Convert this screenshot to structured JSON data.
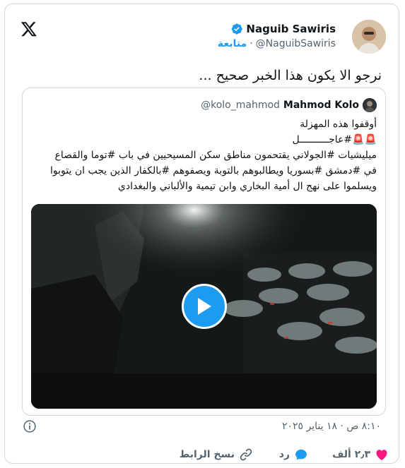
{
  "author": {
    "name": "Naguib Sawiris",
    "handle": "@NaguibSawiris",
    "follow_label": "متابعة",
    "separator": "·"
  },
  "tweet": {
    "text": "نرجو الا يكون هذا الخبر صحيح ..."
  },
  "quote": {
    "name": "Mahmod Kolo",
    "handle": "@kolo_mahmod",
    "lines": [
      "أوقفوا هذه المهزلة",
      "🚨🚨#عاجــــــــــل",
      "ميليشيات #الجولاني يقتحمون مناطق سكن المسيحيين في باب #توما والقصاع",
      "في #دمشق #بسوريا ويطالبوهم بالتوبة ويصفوهم #بالكفار الذين يجب ان يتوبوا",
      "ويسلموا على نهج ال أمية البخاري وابن تيمية والألباني والبغدادي"
    ]
  },
  "timestamp": "٨:١٠ ص · ١٨ يناير ٢٠٢٥",
  "actions": {
    "likes": "٢٫٣ ألف",
    "reply_label": "رد",
    "copy_link_label": "نسخ الرابط"
  },
  "colors": {
    "accent": "#1d9bf0",
    "like": "#f91880",
    "secondary_text": "#536471",
    "border": "#cfd9de"
  },
  "icons": [
    "x-logo-icon",
    "verified-badge-icon",
    "play-icon",
    "info-icon",
    "heart-icon",
    "reply-icon",
    "link-icon"
  ]
}
